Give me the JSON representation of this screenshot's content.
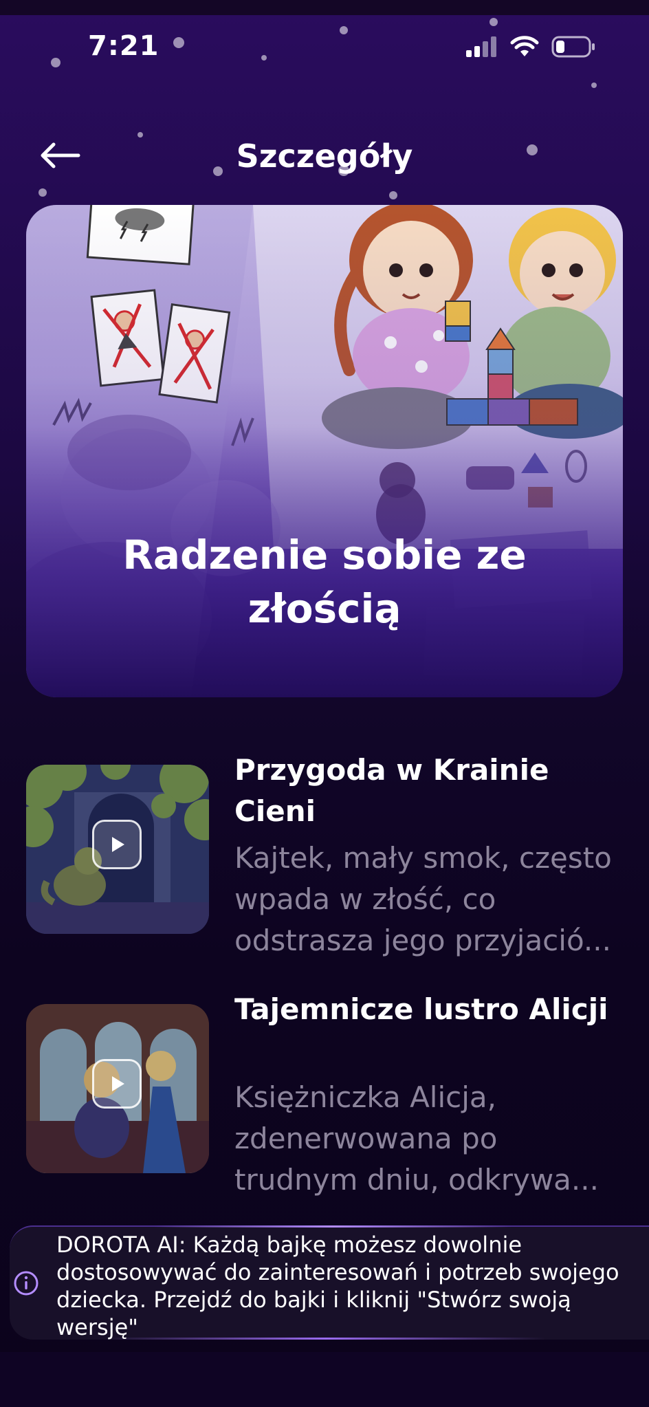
{
  "status_bar": {
    "time": "7:21"
  },
  "header": {
    "title": "Szczegóły"
  },
  "hero": {
    "title": "Radzenie sobie ze złością"
  },
  "stories": [
    {
      "title": "Przygoda w Krainie Cieni",
      "description": "Kajtek, mały smok, często wpada w złość, co odstrasza jego przyjació..."
    },
    {
      "title": "Tajemnicze lustro Alicji",
      "description": "Księżniczka Alicja, zdenerwowana po trudnym dniu, odkrywa..."
    }
  ],
  "toast": {
    "text": "DOROTA AI: Każdą bajkę możesz dowolnie dostosowywać do zainteresowań i potrzeb swojego dziecka. Przejdź do bajki i kliknij \"Stwórz swoją wersję\""
  },
  "icons": {
    "back": "arrow-left-icon",
    "signal": "cellular-signal-icon",
    "wifi": "wifi-icon",
    "battery": "battery-icon",
    "play": "play-icon",
    "info": "info-icon"
  },
  "colors": {
    "background_top": "#2a0c5e",
    "background_bottom": "#0c031c",
    "description_text": "#8d859c",
    "accent": "#9a6cf0"
  }
}
